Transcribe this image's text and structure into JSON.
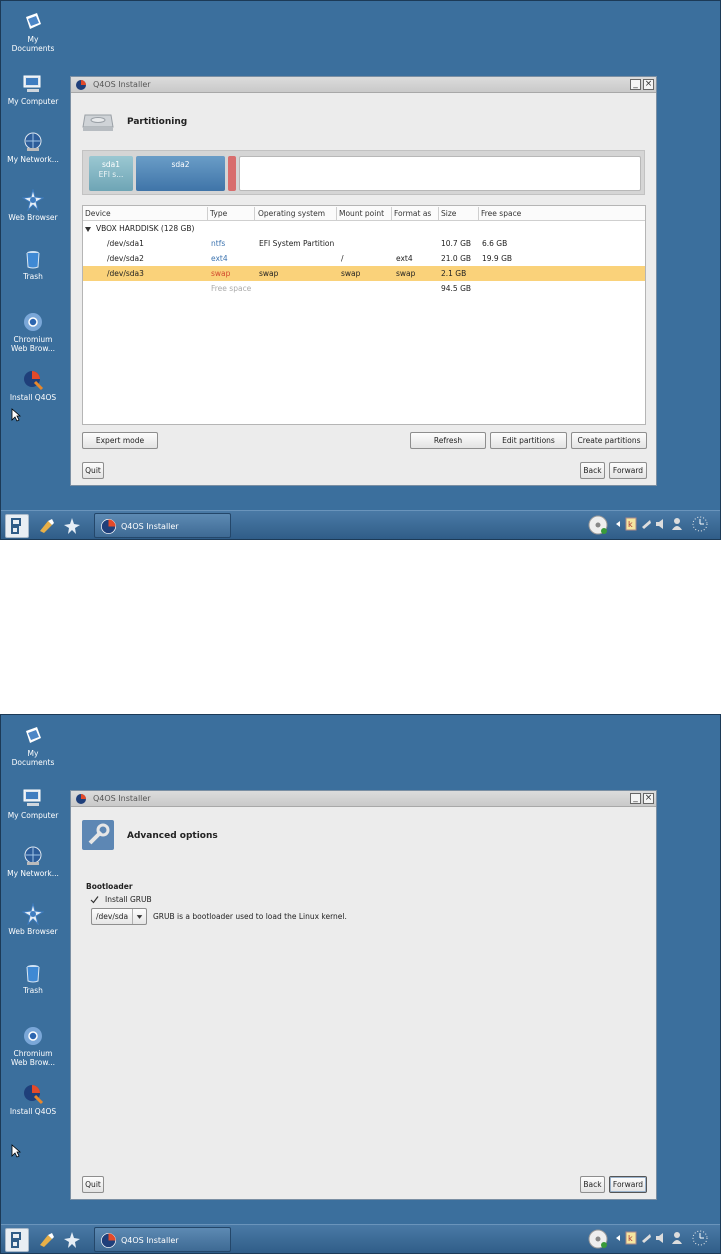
{
  "desktop": {
    "icons": [
      {
        "label": "My Documents"
      },
      {
        "label": "My Computer"
      },
      {
        "label": "My Network..."
      },
      {
        "label": "Web Browser"
      },
      {
        "label": "Trash"
      },
      {
        "label": "Chromium Web Brow..."
      },
      {
        "label": "Install Q4OS"
      }
    ]
  },
  "window": {
    "title": "Q4OS Installer"
  },
  "screen1": {
    "page_title": "Partitioning",
    "partition_bar": {
      "sda1_label": "sda1",
      "sda1_sub": "EFI s...",
      "sda2_label": "sda2"
    },
    "table": {
      "columns": [
        "Device",
        "Type",
        "Operating system",
        "Mount point",
        "Format as",
        "Size",
        "Free space"
      ],
      "disk": "VBOX HARDDISK (128 GB)",
      "rows": [
        {
          "device": "/dev/sda1",
          "type": "ntfs",
          "os": "EFI System Partition",
          "mount": "",
          "format": "",
          "size": "10.7 GB",
          "free": "6.6 GB"
        },
        {
          "device": "/dev/sda2",
          "type": "ext4",
          "os": "",
          "mount": "/",
          "format": "ext4",
          "size": "21.0 GB",
          "free": "19.9 GB"
        },
        {
          "device": "/dev/sda3",
          "type": "swap",
          "os": "swap",
          "mount": "swap",
          "format": "swap",
          "size": "2.1 GB",
          "free": ""
        },
        {
          "device": "",
          "type": "Free space",
          "os": "",
          "mount": "",
          "format": "",
          "size": "94.5 GB",
          "free": ""
        }
      ]
    },
    "buttons": {
      "expert": "Expert mode",
      "refresh": "Refresh",
      "edit": "Edit partitions",
      "create": "Create partitions",
      "quit": "Quit",
      "back": "Back",
      "forward": "Forward"
    }
  },
  "screen2": {
    "page_title": "Advanced options",
    "section": "Bootloader",
    "install_grub": "Install GRUB",
    "device_value": "/dev/sda",
    "grub_desc": "GRUB is a bootloader used to load the Linux kernel.",
    "buttons": {
      "quit": "Quit",
      "back": "Back",
      "forward": "Forward"
    }
  },
  "taskbar": {
    "task_label": "Q4OS Installer"
  },
  "colors": {
    "desktop": "#3b6f9d",
    "selected_row": "#fad27a",
    "swap": "#d24a2e",
    "fs_type": "#3d74b0"
  }
}
